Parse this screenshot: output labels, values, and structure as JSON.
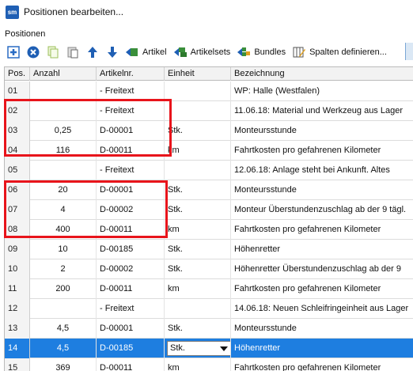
{
  "window": {
    "title": "Positionen bearbeiten..."
  },
  "section": {
    "label": "Positionen"
  },
  "toolbar": {
    "buttons": [
      {
        "label": "Artikel",
        "icon": "add-article-icon"
      },
      {
        "label": "Artikelsets",
        "icon": "add-article-set-icon"
      },
      {
        "label": "Bundles",
        "icon": "add-bundle-icon"
      },
      {
        "label": "Spalten definieren...",
        "icon": "define-columns-icon"
      }
    ]
  },
  "table": {
    "columns": [
      "Pos.",
      "Anzahl",
      "Artikelnr.",
      "Einheit",
      "Bezeichnung"
    ],
    "rows": [
      {
        "pos": "01",
        "anzahl": "",
        "artikelnr": "- Freitext",
        "einheit": "",
        "bezeichnung": "WP: Halle (Westfalen)"
      },
      {
        "pos": "02",
        "anzahl": "",
        "artikelnr": "- Freitext",
        "einheit": "",
        "bezeichnung": " 11.06.18: Material und Werkzeug aus Lager"
      },
      {
        "pos": "03",
        "anzahl": "0,25",
        "artikelnr": "D-00001",
        "einheit": "Stk.",
        "bezeichnung": "Monteursstunde"
      },
      {
        "pos": "04",
        "anzahl": "116",
        "artikelnr": "D-00011",
        "einheit": "km",
        "bezeichnung": "Fahrtkosten pro gefahrenen Kilometer"
      },
      {
        "pos": "05",
        "anzahl": "",
        "artikelnr": "- Freitext",
        "einheit": "",
        "bezeichnung": "12.06.18: Anlage steht bei Ankunft. Altes"
      },
      {
        "pos": "06",
        "anzahl": "20",
        "artikelnr": "D-00001",
        "einheit": "Stk.",
        "bezeichnung": "Monteursstunde"
      },
      {
        "pos": "07",
        "anzahl": "4",
        "artikelnr": "D-00002",
        "einheit": "Stk.",
        "bezeichnung": "Monteur Überstundenzuschlag ab der 9 tägl."
      },
      {
        "pos": "08",
        "anzahl": "400",
        "artikelnr": "D-00011",
        "einheit": "km",
        "bezeichnung": "Fahrtkosten pro gefahrenen Kilometer"
      },
      {
        "pos": "09",
        "anzahl": "10",
        "artikelnr": "D-00185",
        "einheit": "Stk.",
        "bezeichnung": "Höhenretter"
      },
      {
        "pos": "10",
        "anzahl": "2",
        "artikelnr": "D-00002",
        "einheit": "Stk.",
        "bezeichnung": "Höhenretter Überstundenzuschlag ab der 9"
      },
      {
        "pos": "11",
        "anzahl": "200",
        "artikelnr": "D-00011",
        "einheit": "km",
        "bezeichnung": "Fahrtkosten pro gefahrenen Kilometer"
      },
      {
        "pos": "12",
        "anzahl": "",
        "artikelnr": "- Freitext",
        "einheit": "",
        "bezeichnung": "14.06.18: Neuen Schleifringeinheit aus Lager"
      },
      {
        "pos": "13",
        "anzahl": "4,5",
        "artikelnr": "D-00001",
        "einheit": "Stk.",
        "bezeichnung": "Monteursstunde"
      },
      {
        "pos": "14",
        "anzahl": "4,5",
        "artikelnr": "D-00185",
        "einheit": "Stk.",
        "bezeichnung": "Höhenretter"
      },
      {
        "pos": "15",
        "anzahl": "369",
        "artikelnr": "D-00011",
        "einheit": "km",
        "bezeichnung": "Fahrtkosten pro gefahrenen Kilometer"
      }
    ],
    "selected_row": "14"
  },
  "colors": {
    "selection": "#1e7ee0",
    "highlight_box": "#e8141b",
    "app_icon": "#1f5fb4"
  }
}
